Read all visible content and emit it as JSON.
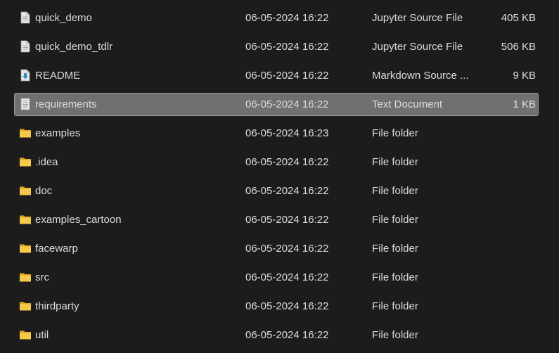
{
  "colors": {
    "background": "#1c1c1c",
    "text": "#dcdcdc",
    "selected_row": "#707070",
    "folder": "#f4c542"
  },
  "files": [
    {
      "name": "quick_demo",
      "date": "06-05-2024 16:22",
      "type": "Jupyter Source File",
      "size": "405 KB",
      "icon": "document-icon",
      "selected": false
    },
    {
      "name": "quick_demo_tdlr",
      "date": "06-05-2024 16:22",
      "type": "Jupyter Source File",
      "size": "506 KB",
      "icon": "document-icon",
      "selected": false
    },
    {
      "name": "README",
      "date": "06-05-2024 16:22",
      "type": "Markdown Source ...",
      "size": "9 KB",
      "icon": "markdown-file-icon",
      "selected": false
    },
    {
      "name": "requirements",
      "date": "06-05-2024 16:22",
      "type": "Text Document",
      "size": "1 KB",
      "icon": "text-document-icon",
      "selected": true
    },
    {
      "name": "examples",
      "date": "06-05-2024 16:23",
      "type": "File folder",
      "size": "",
      "icon": "folder-icon",
      "selected": false
    },
    {
      "name": ".idea",
      "date": "06-05-2024 16:22",
      "type": "File folder",
      "size": "",
      "icon": "folder-icon",
      "selected": false
    },
    {
      "name": "doc",
      "date": "06-05-2024 16:22",
      "type": "File folder",
      "size": "",
      "icon": "folder-icon",
      "selected": false
    },
    {
      "name": "examples_cartoon",
      "date": "06-05-2024 16:22",
      "type": "File folder",
      "size": "",
      "icon": "folder-icon",
      "selected": false
    },
    {
      "name": "facewarp",
      "date": "06-05-2024 16:22",
      "type": "File folder",
      "size": "",
      "icon": "folder-icon",
      "selected": false
    },
    {
      "name": "src",
      "date": "06-05-2024 16:22",
      "type": "File folder",
      "size": "",
      "icon": "folder-icon",
      "selected": false
    },
    {
      "name": "thirdparty",
      "date": "06-05-2024 16:22",
      "type": "File folder",
      "size": "",
      "icon": "folder-icon",
      "selected": false
    },
    {
      "name": "util",
      "date": "06-05-2024 16:22",
      "type": "File folder",
      "size": "",
      "icon": "folder-icon",
      "selected": false
    }
  ]
}
